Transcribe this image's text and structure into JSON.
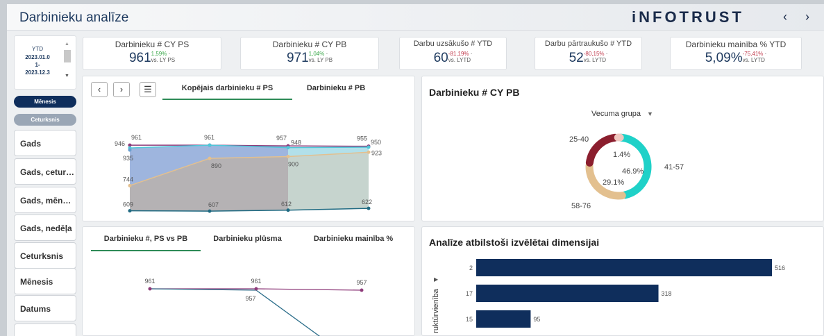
{
  "header": {
    "title": "Darbinieku analīze",
    "logo_text": "iNFOTRUST",
    "prev_icon": "‹",
    "next_icon": "›"
  },
  "kpis": [
    {
      "title": "Darbinieku # CY PS",
      "value": "961",
      "delta": "1,59%",
      "delta_dir": "positive",
      "vs": "vs. LY PS"
    },
    {
      "title": "Darbinieku # CY PB",
      "value": "971",
      "delta": "1,04%",
      "delta_dir": "positive",
      "vs": "vs. LY PB"
    },
    {
      "title": "Darbu uzsākušo # YTD",
      "value": "60",
      "delta": "-81,19%",
      "delta_dir": "negative",
      "vs": "vs. LYTD"
    },
    {
      "title": "Darbu pārtraukušo # YTD",
      "value": "52",
      "delta": "-80,15%",
      "delta_dir": "negative",
      "vs": "vs. LYTD"
    },
    {
      "title": "Darbinieku mainība % YTD",
      "value": "5,09%",
      "delta": "-75,41%",
      "delta_dir": "negative",
      "vs": "vs. LYTD"
    }
  ],
  "date_slicer": {
    "label": "YTD",
    "start_line1": "2023.01.0",
    "start_line2": "1-",
    "end": "2023.12.3"
  },
  "period_toggle": [
    {
      "label": "Mēnesis",
      "active": true
    },
    {
      "label": "Ceturksnis",
      "active": false
    }
  ],
  "dimension_buttons": [
    "Gads",
    "Gads, cetur…",
    "Gads, mēn…",
    "Gads, nedēļa",
    "Ceturksnis",
    "Mēnesis",
    "Datums"
  ],
  "top_chart": {
    "tabs": [
      "Kopējais darbinieku # PS",
      "Darbinieku # PB"
    ],
    "active_tab": 0,
    "list_icon": "☰"
  },
  "donut_panel": {
    "title": "Darbinieku # CY PB",
    "filter_label": "Vecuma grupa",
    "filter_icon": "▼"
  },
  "bottom_left": {
    "tabs": [
      "Darbinieku #, PS vs PB",
      "Darbinieku plūsma",
      "Darbinieku mainība %"
    ],
    "active_tab": 0
  },
  "bar_panel": {
    "title": "Analīze atbilstoši izvēlētai dimensijai",
    "axis_label": "ruktūrvienība",
    "expand_icon": "▶"
  },
  "colors": {
    "navy": "#1e3a5f",
    "dark_navy": "#0f2e5c",
    "teal": "#1fd1c8",
    "dark_red": "#8b1e2e",
    "tan": "#e3c08f",
    "purple": "#8e3b7a",
    "steel": "#2c6e8a"
  },
  "chart_data": [
    {
      "type": "area",
      "series": [
        {
          "values": [
            961,
            961,
            957,
            955
          ],
          "color": "#8e3b7a"
        },
        {
          "values": [
            946,
            961,
            948,
            950
          ],
          "color": "#4fc7d8"
        },
        {
          "values": [
            935,
            null,
            null,
            null
          ],
          "color": "#6a9fd0"
        },
        {
          "values": [
            744,
            890,
            900,
            923
          ],
          "color": "#e3c08f"
        },
        {
          "values": [
            609,
            607,
            612,
            622
          ],
          "color": "#1f6a82"
        }
      ],
      "labels": [
        {
          "text": "946",
          "x": 0,
          "v": 946,
          "dx": -22,
          "dy": -3
        },
        {
          "text": "961",
          "x": 0,
          "v": 961,
          "dx": 2,
          "dy": -8
        },
        {
          "text": "935",
          "x": 0,
          "v": 935,
          "dx": -10,
          "dy": 15
        },
        {
          "text": "744",
          "x": 0,
          "v": 744,
          "dx": -10,
          "dy": -6
        },
        {
          "text": "609",
          "x": 0,
          "v": 609,
          "dx": -10,
          "dy": -6
        },
        {
          "text": "961",
          "x": 1,
          "v": 961,
          "dx": -8,
          "dy": -8
        },
        {
          "text": "890",
          "x": 1,
          "v": 890,
          "dx": 2,
          "dy": 14
        },
        {
          "text": "607",
          "x": 1,
          "v": 607,
          "dx": -2,
          "dy": -6
        },
        {
          "text": "957",
          "x": 2,
          "v": 957,
          "dx": -17,
          "dy": -8
        },
        {
          "text": "948",
          "x": 2,
          "v": 948,
          "dx": 4,
          "dy": -4
        },
        {
          "text": "900",
          "x": 2,
          "v": 900,
          "dx": 0,
          "dy": 14
        },
        {
          "text": "612",
          "x": 2,
          "v": 612,
          "dx": -10,
          "dy": -6
        },
        {
          "text": "955",
          "x": 3,
          "v": 955,
          "dx": -17,
          "dy": -8
        },
        {
          "text": "950",
          "x": 3,
          "v": 950,
          "dx": 3,
          "dy": -4
        },
        {
          "text": "923",
          "x": 3,
          "v": 923,
          "dx": 4,
          "dy": 4
        },
        {
          "text": "622",
          "x": 3,
          "v": 622,
          "dx": -10,
          "dy": -6
        }
      ],
      "ylim": [
        600,
        965
      ]
    },
    {
      "type": "pie",
      "style": "donut",
      "slices": [
        {
          "label": "41-57",
          "value": 46.9,
          "color": "#1fd1c8"
        },
        {
          "label": "58-76",
          "value": 29.1,
          "color": "#e3c08f"
        },
        {
          "label": "25-40",
          "value": 22.6,
          "color": "#8b1e2e"
        },
        {
          "label": "",
          "value": 1.4,
          "color": "#f0c8c0"
        }
      ],
      "value_labels": [
        "46.9%",
        "29.1%",
        "1.4%"
      ]
    },
    {
      "type": "line",
      "series": [
        {
          "values": [
            961,
            961,
            957
          ],
          "color": "#8e3b7a"
        },
        {
          "values": [
            961,
            957,
            null
          ],
          "color": "#2c6e8a"
        }
      ],
      "labels": [
        "961",
        "961",
        "957",
        "957"
      ]
    },
    {
      "type": "bar",
      "orientation": "horizontal",
      "categories": [
        "2",
        "17",
        "15"
      ],
      "values": [
        516,
        318,
        95
      ],
      "color": "#0f2e5c"
    }
  ]
}
